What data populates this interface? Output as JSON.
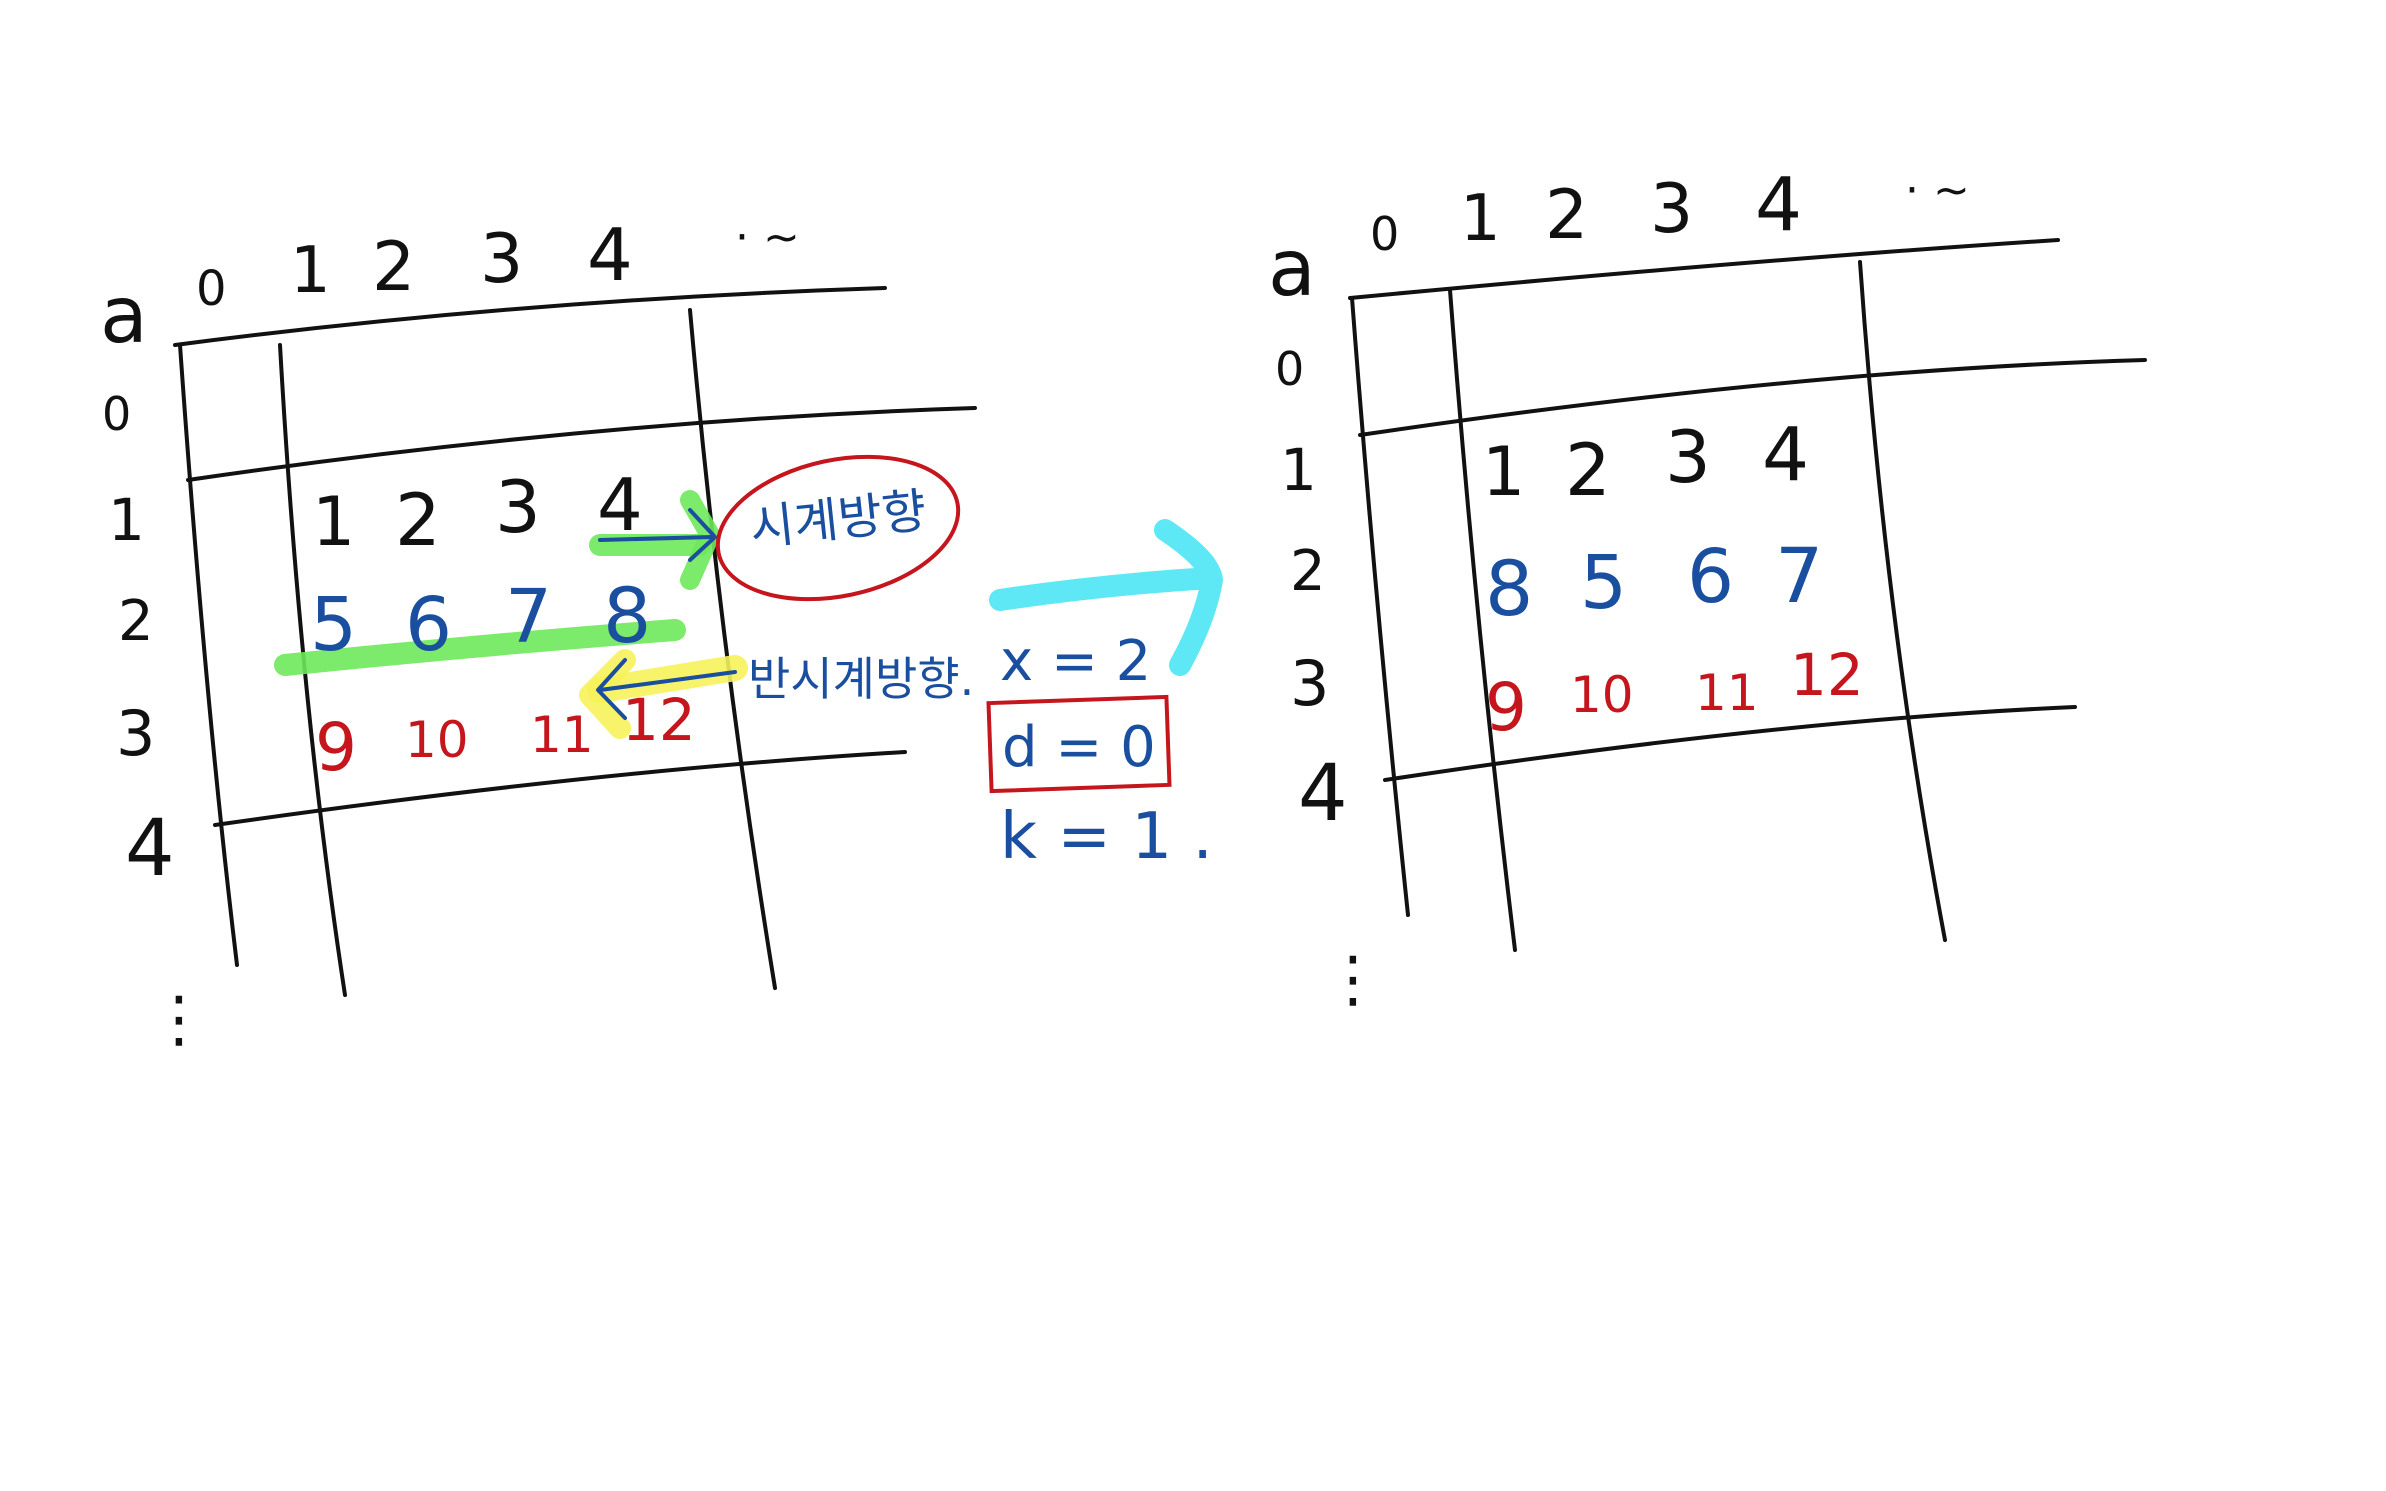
{
  "left_diagram": {
    "corner_label": "a",
    "column_headers": [
      "0",
      "1",
      "2",
      "3",
      "4",
      "· ~"
    ],
    "row_headers": [
      "0",
      "1",
      "2",
      "3",
      "4",
      "⋮"
    ],
    "row1_values": [
      "1",
      "2",
      "3",
      "4"
    ],
    "row2_values": [
      "5",
      "6",
      "7",
      "8"
    ],
    "row3_values": [
      "9",
      "10",
      "11",
      "12"
    ],
    "clockwise_label": "시계방향",
    "counterclockwise_label": "반시계방향.",
    "x_param": "x = 2",
    "d_param": "d = 0",
    "k_param": "k = 1 ."
  },
  "right_diagram": {
    "corner_label": "a",
    "column_headers": [
      "0",
      "1",
      "2",
      "3",
      "4",
      "· ~"
    ],
    "row_headers": [
      "0",
      "1",
      "2",
      "3",
      "4",
      "⋮"
    ],
    "row1_values": [
      "1",
      "2",
      "3",
      "4"
    ],
    "row2_values": [
      "8",
      "5",
      "6",
      "7"
    ],
    "row3_values": [
      "9",
      "10",
      "11",
      "12"
    ]
  },
  "colors": {
    "ink_black": "#111111",
    "ink_blue": "#1a4fa0",
    "ink_red": "#c4161c",
    "highlight_green": "#6ee85a",
    "highlight_yellow": "#f6f25a",
    "highlight_cyan": "#5ee8f5",
    "background": "#ffffff"
  }
}
